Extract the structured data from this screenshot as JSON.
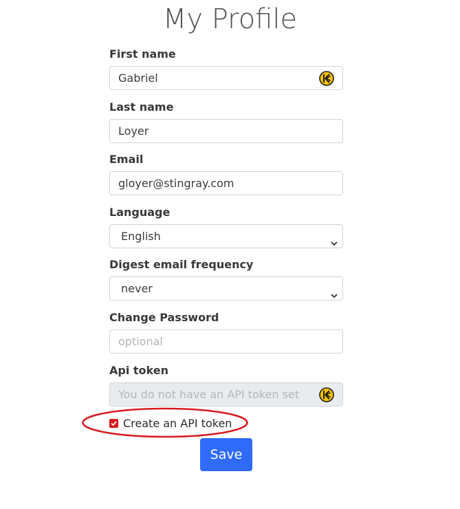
{
  "page": {
    "title": "My Profile"
  },
  "form": {
    "first_name": {
      "label": "First name",
      "value": "Gabriel",
      "icon": "keeper-icon"
    },
    "last_name": {
      "label": "Last name",
      "value": "Loyer"
    },
    "email": {
      "label": "Email",
      "value": "gloyer@stingray.com"
    },
    "language": {
      "label": "Language",
      "selected": "English"
    },
    "digest": {
      "label": "Digest email frequency",
      "selected": "never"
    },
    "password": {
      "label": "Change Password",
      "placeholder": "optional"
    },
    "api_token": {
      "label": "Api token",
      "placeholder": "You do not have an API token set",
      "icon": "keeper-icon"
    },
    "create_token": {
      "label": "Create an API token",
      "checked": true
    },
    "save_label": "Save"
  },
  "colors": {
    "accent": "#2f6bf8",
    "checkbox": "#d7191f",
    "annotation": "#d7191f",
    "keeper_icon": "#f5c200"
  }
}
